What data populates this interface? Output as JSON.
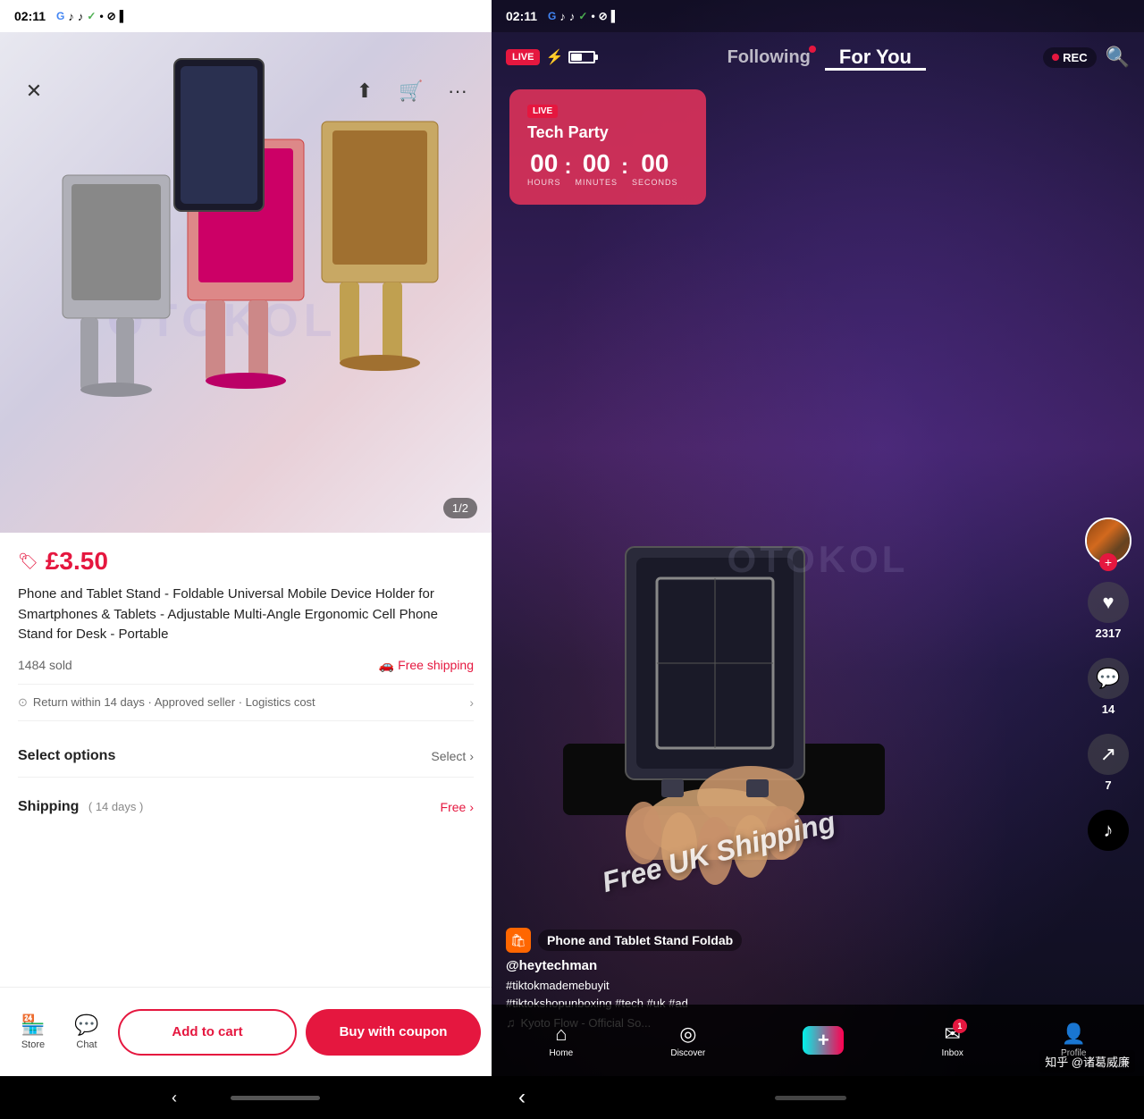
{
  "left": {
    "status_time": "02:11",
    "product_image_counter": "1/2",
    "price": "£3.50",
    "title": "Phone and Tablet Stand - Foldable Universal Mobile Device Holder for Smartphones & Tablets - Adjustable Multi-Angle Ergonomic Cell Phone Stand for Desk - Portable",
    "sold_count": "1484 sold",
    "free_shipping": "Free shipping",
    "return_policy": "Return within 14 days · Approved seller · Logistics cost",
    "select_options_label": "Select options",
    "select_action": "Select",
    "shipping_label": "Shipping",
    "shipping_days": "( 14 days )",
    "shipping_price": "Free",
    "add_to_cart_label": "Add to cart",
    "buy_with_coupon_label": "Buy with coupon",
    "store_label": "Store",
    "chat_label": "Chat",
    "watermark": "OTOKOL"
  },
  "right": {
    "status_time": "02:11",
    "following_tab": "Following",
    "for_you_tab": "For You",
    "rec_label": "REC",
    "live_badge": "LIVE",
    "live_event_title": "Tech Party",
    "hours": "00",
    "minutes": "00",
    "seconds": "00",
    "hours_label": "HOURS",
    "minutes_label": "MINUTES",
    "seconds_label": "SECONDS",
    "free_shipping_overlay": "Free UK Shipping",
    "product_card_title": "Phone and Tablet Stand  Foldab",
    "username": "@heytechman",
    "hashtag1": "#tiktokmademebuyit",
    "hashtag2": "#tiktokshopunboxing #tech #uk #ad",
    "music": "Kyoto Flow - Official So...",
    "likes_count": "2317",
    "comments_count": "14",
    "share_count": "7",
    "watermark_text": "OTOKOL",
    "home_label": "Home",
    "discover_label": "Discover",
    "inbox_label": "Inbox",
    "profile_label": "Profile",
    "inbox_badge": "1",
    "zhihu_watermark": "知乎 @诸葛威廉"
  }
}
